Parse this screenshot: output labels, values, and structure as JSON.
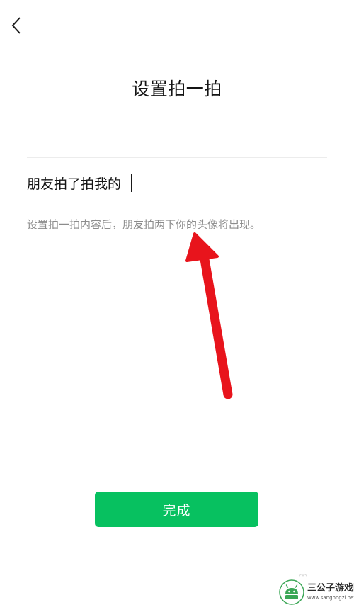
{
  "header": {
    "back_icon": "chevron-left-icon",
    "title": "设置拍一拍"
  },
  "pat_setting": {
    "prefix": "朋友拍了拍我的",
    "input_value": "",
    "hint": "设置拍一拍内容后，朋友拍两下你的头像将出现。"
  },
  "actions": {
    "done_label": "完成"
  },
  "annotation": {
    "arrow_color": "#e8141c"
  },
  "watermark": {
    "name": "三公子游戏网",
    "url": "www.sangongzi.net"
  },
  "colors": {
    "accent": "#07c160",
    "hint": "#8c8c8c",
    "divider": "#ececec"
  }
}
